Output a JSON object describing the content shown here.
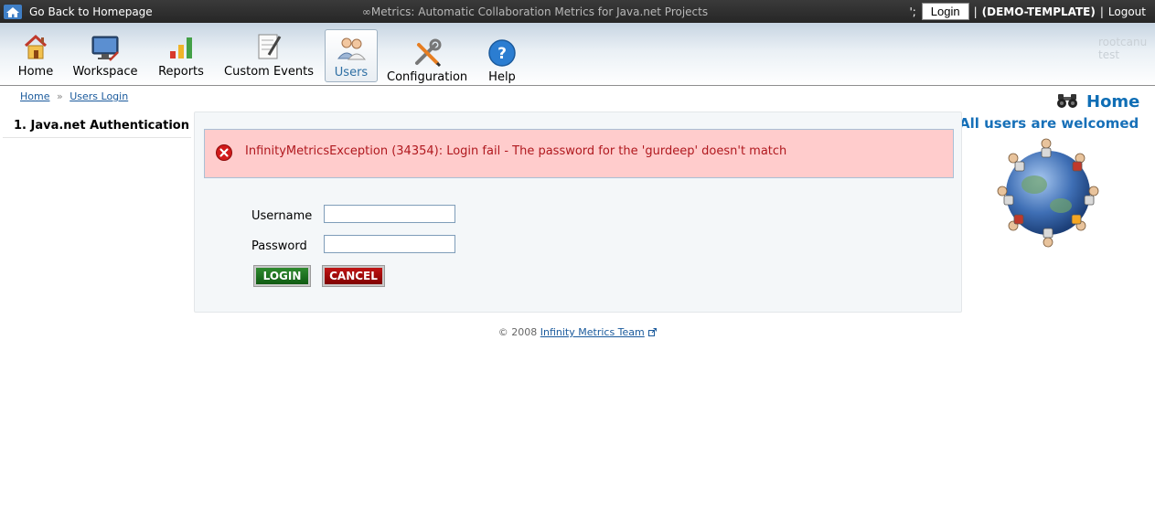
{
  "topbar": {
    "home_link": "Go Back to Homepage",
    "app_title": "∞Metrics: Automatic Collaboration Metrics for Java.net Projects",
    "separator_char": "';",
    "login": "Login",
    "workspace": "(DEMO-TEMPLATE)",
    "logout": "Logout"
  },
  "nav": {
    "items": [
      {
        "label": "Home",
        "icon": "house-icon"
      },
      {
        "label": "Workspace",
        "icon": "workspace-monitor-icon"
      },
      {
        "label": "Reports",
        "icon": "bar-chart-icon"
      },
      {
        "label": "Custom Events",
        "icon": "notepad-pencil-icon"
      },
      {
        "label": "Users",
        "icon": "users-icon",
        "active": true
      },
      {
        "label": "Configuration",
        "icon": "wrench-screwdriver-icon"
      },
      {
        "label": "Help",
        "icon": "help-question-icon"
      }
    ],
    "ghost_lines": [
      "rootcanu",
      "test"
    ]
  },
  "breadcrumb": {
    "home": "Home",
    "separator": "»",
    "current": "Users Login"
  },
  "steps": [
    "1. Java.net Authentication"
  ],
  "error": {
    "message": "InfinityMetricsException (34354): Login fail - The password for the 'gurdeep' doesn't match"
  },
  "form": {
    "username_label": "Username",
    "username_value": "",
    "password_label": "Password",
    "password_value": "",
    "login_button": "LOGIN",
    "cancel_button": "CANCEL"
  },
  "sidebar": {
    "home_heading": "Home",
    "welcome": "All users are welcomed"
  },
  "footer": {
    "copyright": "© 2008",
    "team_link": "Infinity Metrics Team"
  },
  "colors": {
    "error_bg": "#ffcccc",
    "error_text": "#b0181e",
    "link": "#1a5a9c",
    "heading_blue": "#0f6eb5",
    "login_green": "#0f5a12",
    "cancel_red": "#7f0000"
  }
}
